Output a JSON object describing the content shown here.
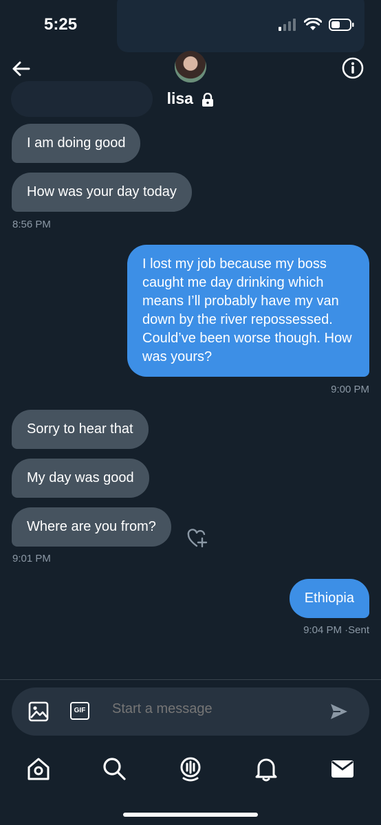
{
  "status": {
    "time": "5:25"
  },
  "header": {
    "name": "lisa"
  },
  "messages": {
    "m1": "I am doing good",
    "m2": "How was your day today",
    "t1": "8:56 PM",
    "m3": "I lost my job because my boss caught me day drinking which means I’ll probably have my van down by the river repossessed. Could’ve been worse though. How was yours?",
    "t2": "9:00 PM",
    "m4": "Sorry to hear that",
    "m5": "My day was good",
    "m6": "Where are you from?",
    "t3": "9:01 PM",
    "m7": "Ethiopia",
    "t4": "9:04 PM",
    "t4_status": "Sent"
  },
  "composer": {
    "placeholder": "Start a message",
    "gif_label": "GIF"
  },
  "tabs": [
    "home-icon",
    "search-icon",
    "spaces-icon",
    "notifications-icon",
    "messages-icon"
  ]
}
